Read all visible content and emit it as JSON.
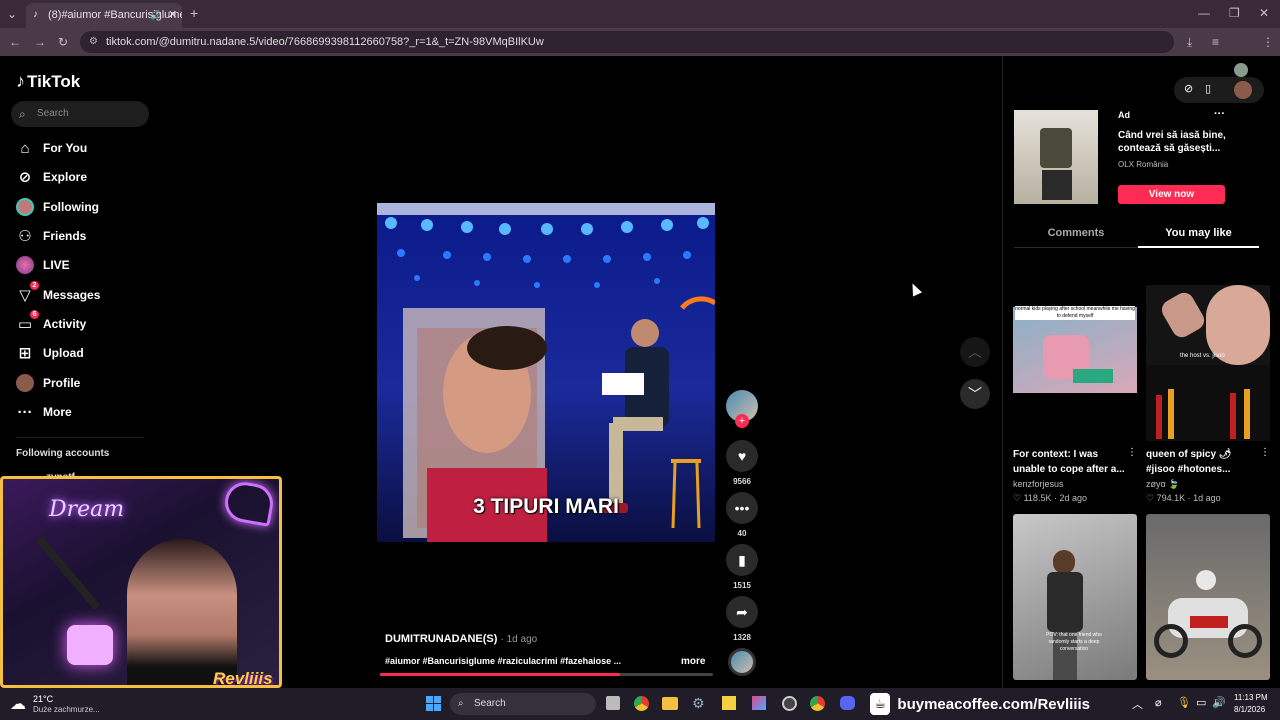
{
  "browser": {
    "tab_title": "(8)#aiumor #Bancurisiglume",
    "url": "tiktok.com/@dumitru.nadane.5/video/7668699398112660758?_r=1&_t=ZN-98VMqBIlKUw"
  },
  "tiktok": {
    "logo": "TikTok",
    "search_placeholder": "Search",
    "nav": [
      {
        "label": "For You",
        "icon": "home-icon"
      },
      {
        "label": "Explore",
        "icon": "compass-icon"
      },
      {
        "label": "Following",
        "icon": "following-avatar-icon"
      },
      {
        "label": "Friends",
        "icon": "friends-icon"
      },
      {
        "label": "LIVE",
        "icon": "live-icon"
      },
      {
        "label": "Messages",
        "icon": "messages-icon",
        "badge": "2"
      },
      {
        "label": "Activity",
        "icon": "activity-icon",
        "badge": "6"
      },
      {
        "label": "Upload",
        "icon": "upload-icon"
      },
      {
        "label": "Profile",
        "icon": "profile-avatar-icon"
      },
      {
        "label": "More",
        "icon": "more-icon"
      }
    ],
    "following_accounts_heading": "Following accounts",
    "following_account_name": "zvnstf"
  },
  "video": {
    "caption_overlay": "3 TIPURI MARI",
    "author": "DUMITRUNADANE(S)",
    "age": "· 1d ago",
    "description": "#aiumor #Bancurisiglume #raziculacrimi #fazehaiose ...",
    "more_label": "more",
    "progress": 0.72
  },
  "actions": {
    "likes": "9566",
    "comments": "40",
    "saves": "1515",
    "shares": "1328"
  },
  "ad": {
    "label": "Ad",
    "title": "Când vrei să iasă bine, contează să găsești...",
    "advertiser": "OLX România",
    "cta": "View now"
  },
  "panel_tabs": {
    "comments": "Comments",
    "you_may_like": "You may like"
  },
  "recommendations": [
    {
      "overlay": "normal kids playing after school meanwhile me having to defend myself",
      "title": "For context: I was unable to cope after a...",
      "author": "kenzforjesus",
      "likes": "118.5K",
      "age": "· 2d ago"
    },
    {
      "overlay": "the host vs. jisoo",
      "title": "queen of spicy 🌶 #jisoo #hotones...",
      "author": "zøyα 🍃",
      "likes": "794.1K",
      "age": "· 1d ago"
    },
    {
      "overlay": "POV: that one friend who randomly starts a deep conversation",
      "title": "",
      "author": "",
      "likes": "",
      "age": ""
    },
    {
      "overlay": "",
      "title": "",
      "author": "",
      "likes": "",
      "age": ""
    }
  ],
  "webcam": {
    "neon_text": "Dream",
    "tag": "Revliiis"
  },
  "taskbar": {
    "temperature": "21°C",
    "weather": "Duże zachmurze...",
    "search": "Search",
    "promo": "buymeacoffee.com/Revliiis",
    "time": "11:13 PM",
    "date": "8/1/2026"
  },
  "colors": {
    "accent": "#fe2c55",
    "chrome_tab_bar": "#3a2a38",
    "taskbar": "#201c28"
  }
}
